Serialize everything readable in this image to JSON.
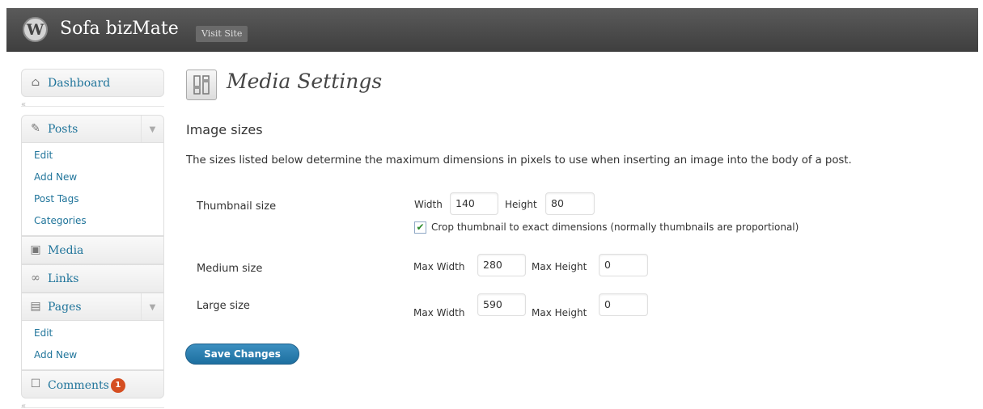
{
  "header": {
    "site_title": "Sofa bizMate",
    "visit_site_label": "Visit Site"
  },
  "sidebar": {
    "dashboard": "Dashboard",
    "posts": {
      "label": "Posts",
      "items": [
        "Edit",
        "Add New",
        "Post Tags",
        "Categories"
      ]
    },
    "media": "Media",
    "links": "Links",
    "pages": {
      "label": "Pages",
      "items": [
        "Edit",
        "Add New"
      ]
    },
    "comments": {
      "label": "Comments",
      "badge": "1"
    }
  },
  "main": {
    "title": "Media Settings",
    "section_title": "Image sizes",
    "description": "The sizes listed below determine the maximum dimensions in pixels to use when inserting an image into the body of a post.",
    "thumbnail": {
      "label": "Thumbnail size",
      "width_label": "Width",
      "width_value": "140",
      "height_label": "Height",
      "height_value": "80",
      "crop_checked": true,
      "crop_label": "Crop thumbnail to exact dimensions (normally thumbnails are proportional)"
    },
    "medium": {
      "label": "Medium size",
      "max_width_label": "Max Width",
      "max_width_value": "280",
      "max_height_label": "Max Height",
      "max_height_value": "0"
    },
    "large": {
      "label": "Large size",
      "max_width_label": "Max Width",
      "max_width_value": "590",
      "max_height_label": "Max Height",
      "max_height_value": "0"
    },
    "save_label": "Save Changes"
  }
}
